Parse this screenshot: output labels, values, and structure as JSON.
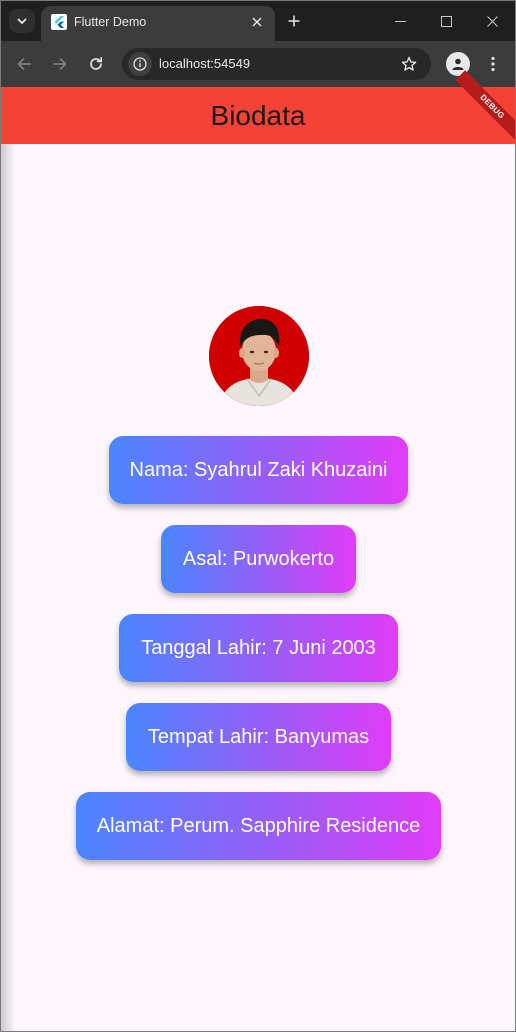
{
  "browser": {
    "tab_title": "Flutter Demo",
    "url": "localhost:54549",
    "icons": {
      "tab_search": "chevron-down-icon",
      "tab_close": "close-icon",
      "new_tab": "plus-icon",
      "minimize": "minimize-icon",
      "maximize": "maximize-icon",
      "close_window": "close-icon",
      "back": "arrow-left-icon",
      "forward": "arrow-right-icon",
      "reload": "reload-icon",
      "site_info": "info-icon",
      "bookmark": "star-icon",
      "profile": "person-icon",
      "menu": "more-vert-icon"
    }
  },
  "app": {
    "title": "Biodata",
    "debug_banner": "DEBUG",
    "colors": {
      "appbar": "#f44336",
      "background": "#fdf6fd",
      "gradient_start": "#4a86ff",
      "gradient_end": "#e13cf9"
    },
    "items": [
      {
        "text": "Nama: Syahrul Zaki Khuzaini"
      },
      {
        "text": "Asal: Purwokerto"
      },
      {
        "text": "Tanggal Lahir: 7 Juni 2003"
      },
      {
        "text": "Tempat Lahir: Banyumas"
      },
      {
        "text": "Alamat: Perum. Sapphire Residence"
      }
    ]
  }
}
